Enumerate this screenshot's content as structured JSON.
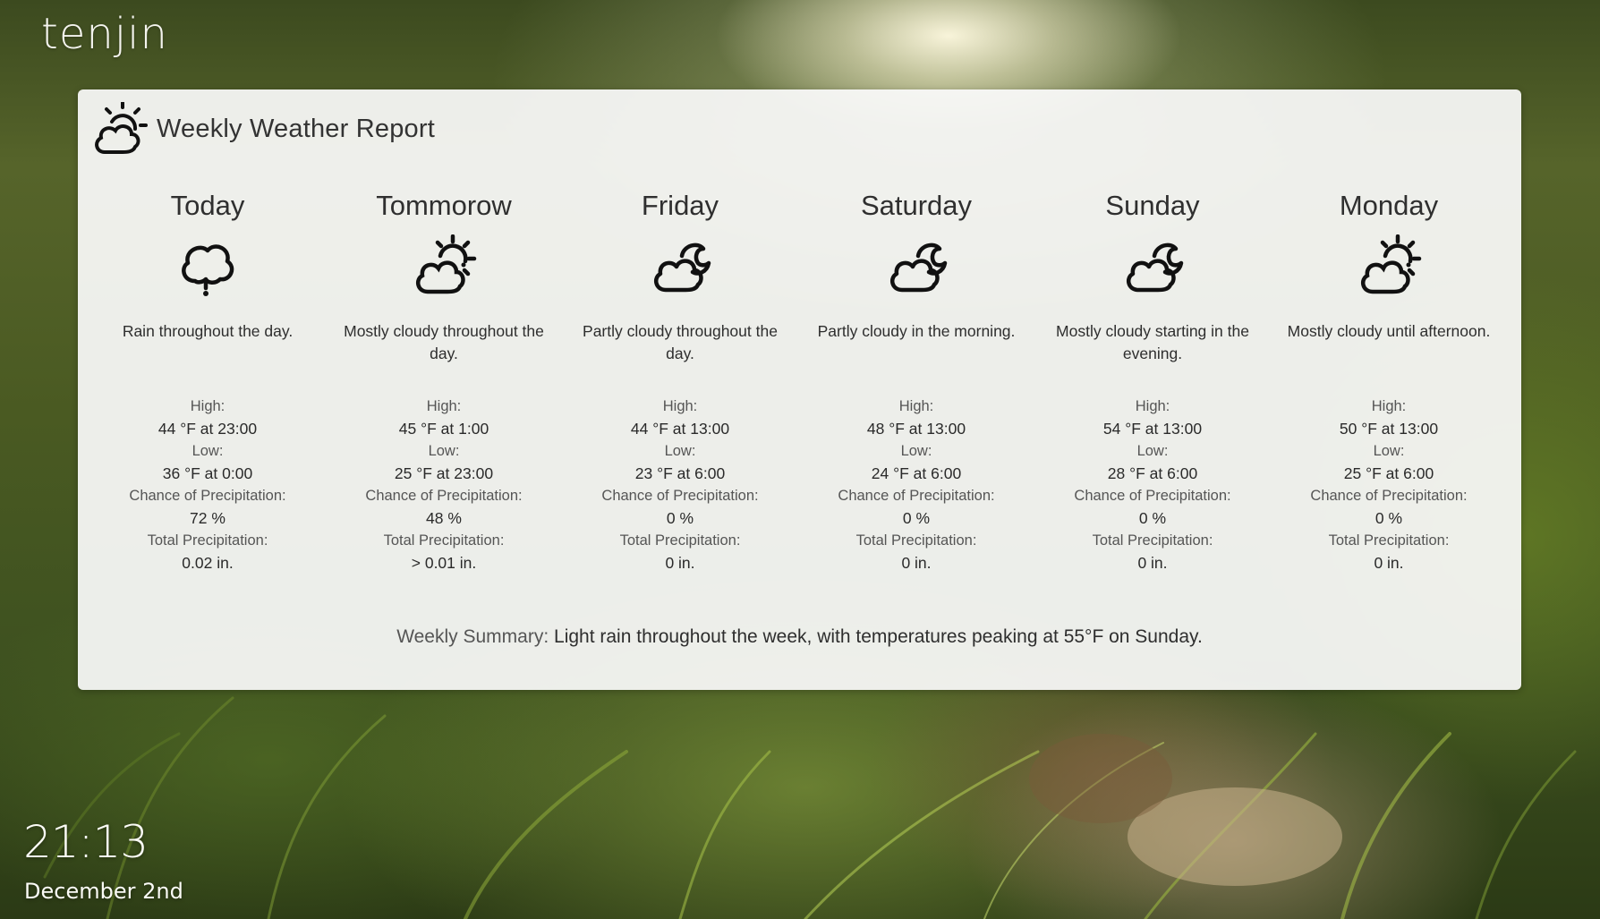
{
  "app": {
    "logo": "tenjin"
  },
  "card": {
    "title": "Weekly Weather Report",
    "icon": "partly-cloudy-icon"
  },
  "days": [
    {
      "name": "Today",
      "icon": "rain-icon",
      "summary": "Rain throughout the day.",
      "high_label": "High:",
      "high": "44 °F at 23:00",
      "low_label": "Low:",
      "low": "36 °F at 0:00",
      "precip_chance_label": "Chance of Precipitation:",
      "precip_chance": "72 %",
      "precip_total_label": "Total Precipitation:",
      "precip_total": "0.02 in."
    },
    {
      "name": "Tommorow",
      "icon": "partly-cloudy-day-icon",
      "summary": "Mostly cloudy throughout the day.",
      "high_label": "High:",
      "high": "45 °F at 1:00",
      "low_label": "Low:",
      "low": "25 °F at 23:00",
      "precip_chance_label": "Chance of Precipitation:",
      "precip_chance": "48 %",
      "precip_total_label": "Total Precipitation:",
      "precip_total": "> 0.01 in."
    },
    {
      "name": "Friday",
      "icon": "partly-cloudy-night-icon",
      "summary": "Partly cloudy throughout the day.",
      "high_label": "High:",
      "high": "44 °F at 13:00",
      "low_label": "Low:",
      "low": "23 °F at 6:00",
      "precip_chance_label": "Chance of Precipitation:",
      "precip_chance": "0 %",
      "precip_total_label": "Total Precipitation:",
      "precip_total": "0 in."
    },
    {
      "name": "Saturday",
      "icon": "partly-cloudy-night-icon",
      "summary": "Partly cloudy in the morning.",
      "high_label": "High:",
      "high": "48 °F at 13:00",
      "low_label": "Low:",
      "low": "24 °F at 6:00",
      "precip_chance_label": "Chance of Precipitation:",
      "precip_chance": "0 %",
      "precip_total_label": "Total Precipitation:",
      "precip_total": "0 in."
    },
    {
      "name": "Sunday",
      "icon": "partly-cloudy-night-icon",
      "summary": "Mostly cloudy starting in the evening.",
      "high_label": "High:",
      "high": "54 °F at 13:00",
      "low_label": "Low:",
      "low": "28 °F at 6:00",
      "precip_chance_label": "Chance of Precipitation:",
      "precip_chance": "0 %",
      "precip_total_label": "Total Precipitation:",
      "precip_total": "0 in."
    },
    {
      "name": "Monday",
      "icon": "partly-cloudy-day-icon",
      "summary": "Mostly cloudy until afternoon.",
      "high_label": "High:",
      "high": "50 °F at 13:00",
      "low_label": "Low:",
      "low": "25 °F at 6:00",
      "precip_chance_label": "Chance of Precipitation:",
      "precip_chance": "0 %",
      "precip_total_label": "Total Precipitation:",
      "precip_total": "0 in."
    }
  ],
  "weekly": {
    "label": "Weekly Summary:",
    "text": "Light rain throughout the week, with temperatures peaking at 55°F on Sunday."
  },
  "clock": {
    "time": "21:13",
    "date": "December 2nd"
  }
}
